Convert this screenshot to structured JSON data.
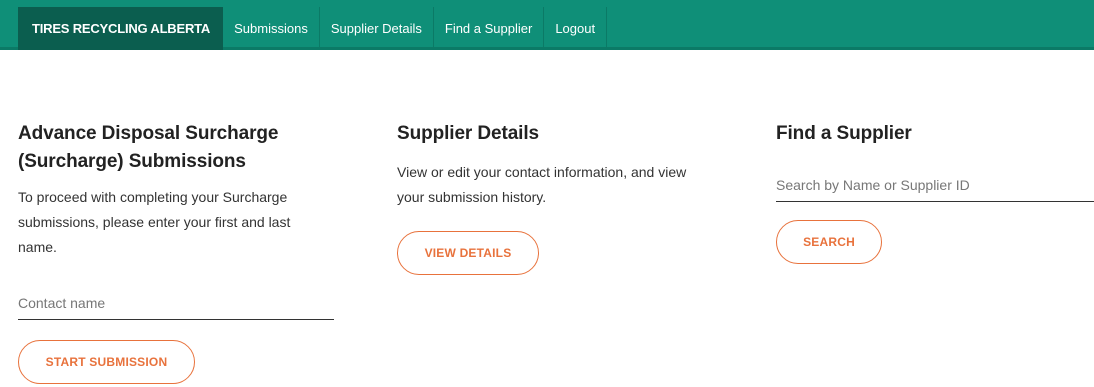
{
  "nav": {
    "brand": "TIRES RECYCLING ALBERTA",
    "items": [
      {
        "label": "Submissions"
      },
      {
        "label": "Supplier Details"
      },
      {
        "label": "Find a Supplier"
      },
      {
        "label": "Logout"
      }
    ]
  },
  "sections": {
    "submissions": {
      "title": "Advance Disposal Surcharge (Surcharge) Submissions",
      "description": "To proceed with completing your Surcharge submissions, please enter your first and last name.",
      "input_placeholder": "Contact name",
      "input_value": "",
      "button_label": "START SUBMISSION"
    },
    "supplier_details": {
      "title": "Supplier Details",
      "description": "View or edit your contact information, and view your submission history.",
      "button_label": "VIEW DETAILS"
    },
    "find_supplier": {
      "title": "Find a Supplier",
      "input_placeholder": "Search by Name or Supplier ID",
      "input_value": "",
      "button_label": "SEARCH"
    }
  },
  "colors": {
    "nav_background": "#0f8f78",
    "brand_background": "#0b5e4f",
    "accent": "#e8723c"
  }
}
